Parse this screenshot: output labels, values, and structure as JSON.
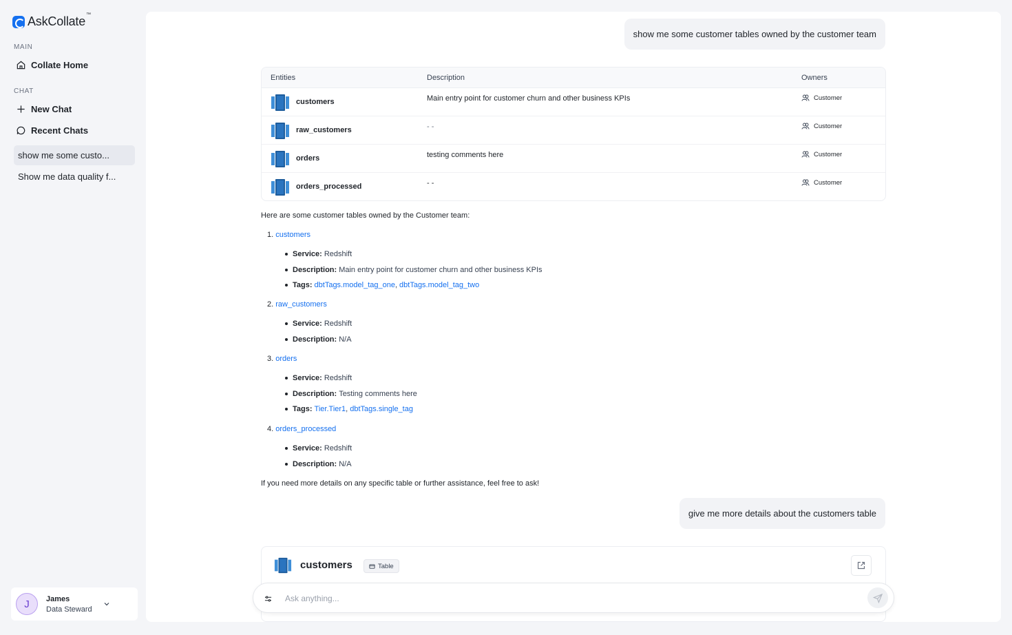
{
  "app": {
    "name": "AskCollate",
    "trademark": "™"
  },
  "sidebar": {
    "main_label": "MAIN",
    "home": "Collate Home",
    "chat_label": "CHAT",
    "new_chat": "New Chat",
    "recent_chats": "Recent Chats",
    "chats": [
      {
        "label": "show me some custo...",
        "active": true
      },
      {
        "label": "Show me data quality f...",
        "active": false
      }
    ]
  },
  "user": {
    "initial": "J",
    "name": "James",
    "role": "Data Steward"
  },
  "conversation": {
    "user_message_1": "show me some customer tables owned by the customer team",
    "table": {
      "headers": [
        "Entities",
        "Description",
        "Owners"
      ],
      "rows": [
        {
          "name": "customers",
          "description": "Main entry point for customer churn and other business KPIs",
          "owner": "Customer"
        },
        {
          "name": "raw_customers",
          "description": "- -",
          "owner": "Customer"
        },
        {
          "name": "orders",
          "description": "testing comments here",
          "owner": "Customer"
        },
        {
          "name": "orders_processed",
          "description": "- -",
          "owner": "Customer"
        }
      ]
    },
    "answer": {
      "intro": "Here are some customer tables owned by the Customer team:",
      "labels": {
        "service": "Service:",
        "description": "Description:",
        "tags": "Tags:"
      },
      "items": [
        {
          "num": "1.",
          "name": "customers",
          "service": "Redshift",
          "description": "Main entry point for customer churn and other business KPIs",
          "tags": [
            "dbtTags.model_tag_one",
            "dbtTags.model_tag_two"
          ]
        },
        {
          "num": "2.",
          "name": "raw_customers",
          "service": "Redshift",
          "description": "N/A"
        },
        {
          "num": "3.",
          "name": "orders",
          "service": "Redshift",
          "description": "Testing comments here",
          "tags": [
            "Tier.Tier1",
            "dbtTags.single_tag"
          ]
        },
        {
          "num": "4.",
          "name": "orders_processed",
          "service": "Redshift",
          "description": "N/A"
        }
      ],
      "outro": "If you need more details on any specific table or further assistance, feel free to ask!"
    },
    "user_message_2": "give me more details about the customers table",
    "detail_card": {
      "title": "customers",
      "type": "Table"
    }
  },
  "composer": {
    "placeholder": "Ask anything..."
  },
  "colors": {
    "accent": "#1570ef",
    "db_icon": "#1e6fb8",
    "avatar_bg": "#e9defb"
  },
  "icons": [
    "home-icon",
    "plus-icon",
    "chat-bubble-icon",
    "chevron-down-icon",
    "database-icon",
    "owner-team-icon",
    "table-icon",
    "external-link-icon",
    "settings-sliders-icon",
    "send-icon"
  ]
}
